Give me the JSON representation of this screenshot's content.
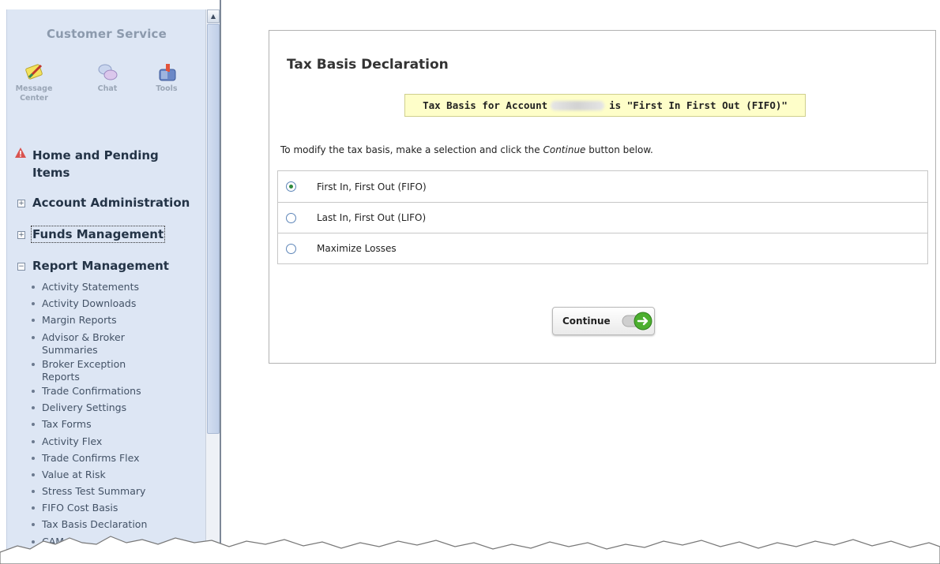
{
  "sidebar": {
    "title": "Customer Service",
    "tools": [
      {
        "label_line1": "Message",
        "label_line2": "Center",
        "icon": "message-center-icon"
      },
      {
        "label_line1": "Chat",
        "label_line2": "",
        "icon": "chat-icon"
      },
      {
        "label_line1": "Tools",
        "label_line2": "",
        "icon": "tools-icon"
      }
    ],
    "home_line1": "Home and Pending",
    "home_line2": "Items",
    "sections": {
      "account_admin": {
        "label": "Account Administration",
        "toggle": "+"
      },
      "funds": {
        "label": "Funds Management",
        "toggle": "+"
      },
      "report": {
        "label": "Report Management",
        "toggle": "−"
      }
    },
    "report_items": [
      "Activity Statements",
      "Activity Downloads",
      "Margin Reports",
      "Advisor & Broker Summaries",
      "Broker Exception Reports",
      "Trade Confirmations",
      "Delivery Settings",
      "Tax Forms",
      "Activity Flex",
      "Trade Confirms Flex",
      "Value at Risk",
      "Stress Test Summary",
      "FIFO Cost Basis",
      "Tax Basis Declaration",
      "CAM"
    ]
  },
  "scrollbar": {
    "up_arrow": "▲"
  },
  "main": {
    "title": "Tax Basis Declaration",
    "notice_prefix": "Tax Basis for Account",
    "notice_suffix": "is \"First In First Out (FIFO)\"",
    "instruction_prefix": "To modify the tax basis, make a selection and click the ",
    "instruction_em": "Continue",
    "instruction_suffix": " button below.",
    "options": [
      {
        "label": "First In, First Out (FIFO)",
        "checked": true
      },
      {
        "label": "Last In, First Out (LIFO)",
        "checked": false
      },
      {
        "label": "Maximize Losses",
        "checked": false
      }
    ],
    "continue_label": "Continue"
  },
  "colors": {
    "sidebar_bg": "#dde6f4",
    "notice_bg": "#fefec9",
    "radio_checked": "#2f8a3c",
    "continue_arrow": "#4caf2f",
    "warning": "#d9534f"
  }
}
